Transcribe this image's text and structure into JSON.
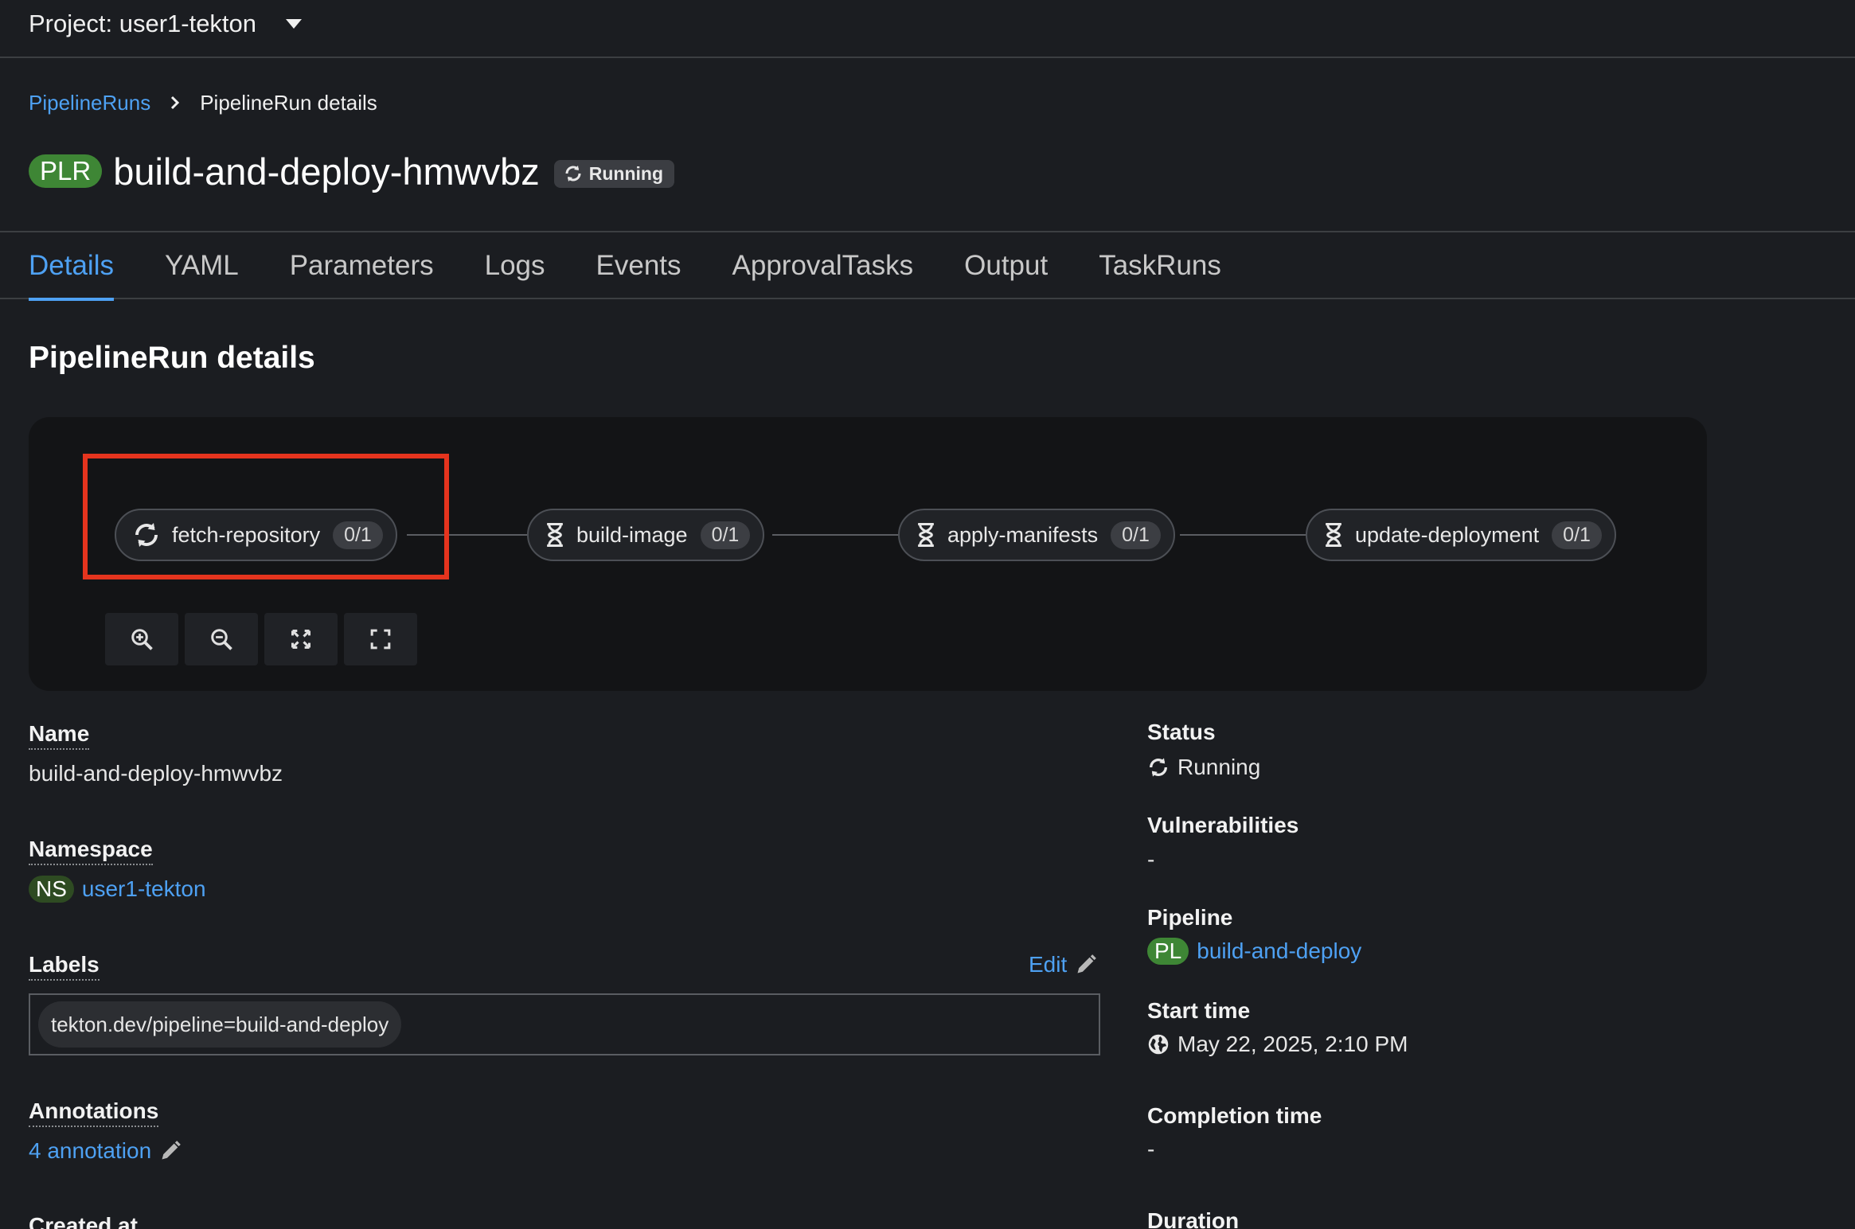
{
  "project": {
    "label": "Project: user1-tekton"
  },
  "breadcrumb": {
    "parent": "PipelineRuns",
    "current": "PipelineRun details"
  },
  "header": {
    "badge": "PLR",
    "title": "build-and-deploy-hmwvbz",
    "status": "Running"
  },
  "tabs": [
    "Details",
    "YAML",
    "Parameters",
    "Logs",
    "Events",
    "ApprovalTasks",
    "Output",
    "TaskRuns"
  ],
  "section_title": "PipelineRun details",
  "pipeline_graph": {
    "tasks": [
      {
        "name": "fetch-repository",
        "count": "0/1",
        "icon": "sync-icon"
      },
      {
        "name": "build-image",
        "count": "0/1",
        "icon": "hourglass-icon"
      },
      {
        "name": "apply-manifests",
        "count": "0/1",
        "icon": "hourglass-icon"
      },
      {
        "name": "update-deployment",
        "count": "0/1",
        "icon": "hourglass-icon"
      }
    ],
    "controls": [
      "zoom-in-icon",
      "zoom-out-icon",
      "fit-to-screen-icon",
      "expand-icon"
    ],
    "highlight_color": "#e5341e"
  },
  "details": {
    "name_label": "Name",
    "name_value": "build-and-deploy-hmwvbz",
    "namespace_label": "Namespace",
    "namespace_badge": "NS",
    "namespace_value": "user1-tekton",
    "labels_label": "Labels",
    "labels_edit": "Edit",
    "labels": [
      "tekton.dev/pipeline=build-and-deploy"
    ],
    "annotations_label": "Annotations",
    "annotations_value": "4 annotation",
    "created_label": "Created at",
    "status_label": "Status",
    "status_value": "Running",
    "vulnerabilities_label": "Vulnerabilities",
    "vulnerabilities_value": "-",
    "pipeline_label": "Pipeline",
    "pipeline_badge": "PL",
    "pipeline_value": "build-and-deploy",
    "start_label": "Start time",
    "start_value": "May 22, 2025, 2:10 PM",
    "completion_label": "Completion time",
    "completion_value": "-",
    "duration_label": "Duration"
  },
  "colors": {
    "link": "#4ea1f3",
    "accent_green": "#3e8635",
    "background": "#1b1d21"
  }
}
